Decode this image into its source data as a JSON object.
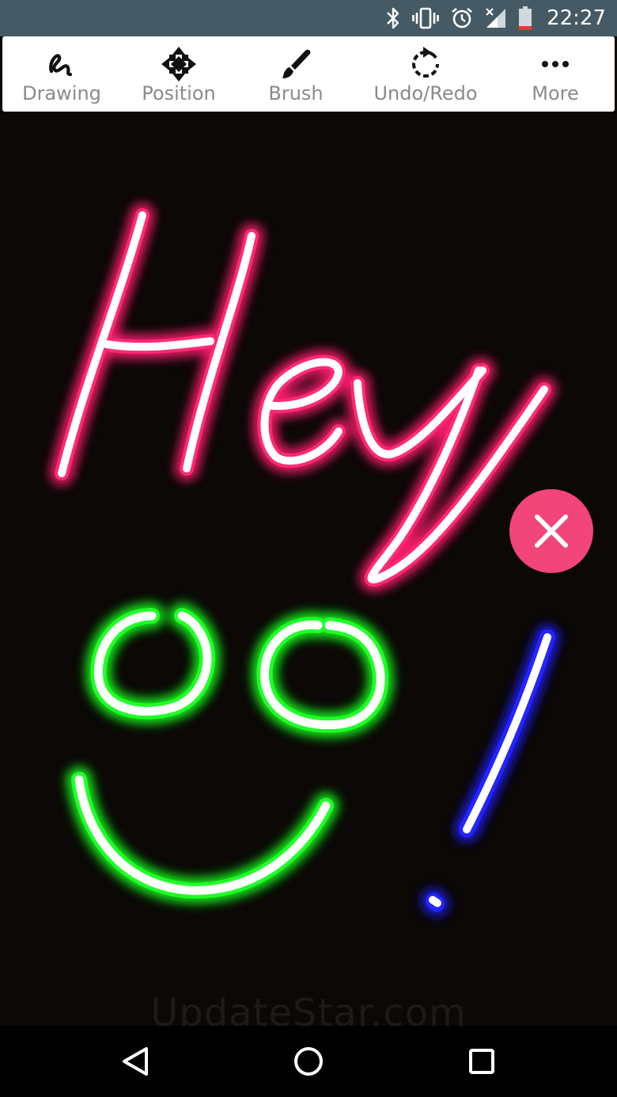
{
  "status_bar": {
    "time": "22:27",
    "icons": [
      "bluetooth-icon",
      "vibrate-icon",
      "alarm-icon",
      "signal-icon",
      "battery-icon"
    ],
    "background_color": "#455a64"
  },
  "toolbar": {
    "items": [
      {
        "label": "Drawing",
        "icon": "squiggle-icon"
      },
      {
        "label": "Position",
        "icon": "move-arrows-icon"
      },
      {
        "label": "Brush",
        "icon": "brush-icon"
      },
      {
        "label": "Undo/Redo",
        "icon": "undo-redo-icon"
      },
      {
        "label": "More",
        "icon": "more-dots-icon"
      }
    ]
  },
  "canvas": {
    "background_color": "#0b0806",
    "strokes": [
      {
        "name": "hey-text",
        "glow_color": "#ff1f6e",
        "core_color": "#ffffff"
      },
      {
        "name": "smiley-face",
        "glow_color": "#12ff1a",
        "core_color": "#ffffff"
      },
      {
        "name": "exclamation-mark",
        "glow_color": "#1a1aff",
        "core_color": "#ffffff"
      }
    ],
    "close_button": {
      "icon": "close-icon",
      "color": "#f2457a"
    },
    "watermark": "UpdateStar.com"
  },
  "nav_bar": {
    "buttons": [
      "back-icon",
      "home-icon",
      "recents-icon"
    ]
  }
}
